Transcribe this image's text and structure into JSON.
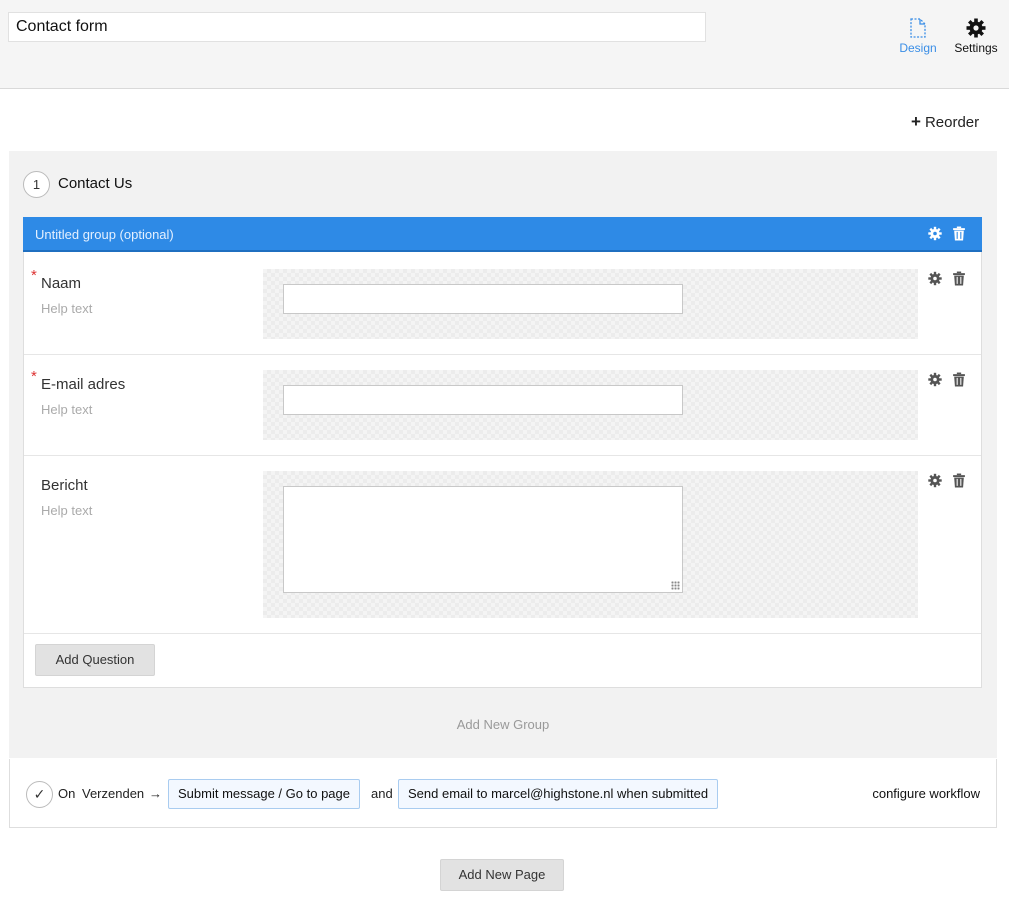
{
  "header": {
    "form_title": "Contact form",
    "design_label": "Design",
    "settings_label": "Settings"
  },
  "reorder_label": "Reorder",
  "page": {
    "number": "1",
    "title": "Contact Us",
    "group": {
      "title": "Untitled group (optional)",
      "questions": [
        {
          "label": "Naam",
          "help": "Help text",
          "required": true
        },
        {
          "label": "E-mail adres",
          "help": "Help text",
          "required": true
        },
        {
          "label": "Bericht",
          "help": "Help text",
          "required": false
        }
      ],
      "add_question_label": "Add Question"
    },
    "add_group_label": "Add New Group"
  },
  "workflow": {
    "on_label": "On",
    "trigger": "Verzenden",
    "arrow": "→",
    "action1": "Submit message / Go to page",
    "and_label": "and",
    "action2": "Send email to marcel@highstone.nl when submitted",
    "configure_label": "configure workflow"
  },
  "add_page_label": "Add New Page",
  "required_marker": "*",
  "colors": {
    "accent": "#2e8ae6",
    "design_active": "#3a8ee6",
    "required": "#dd3333"
  }
}
